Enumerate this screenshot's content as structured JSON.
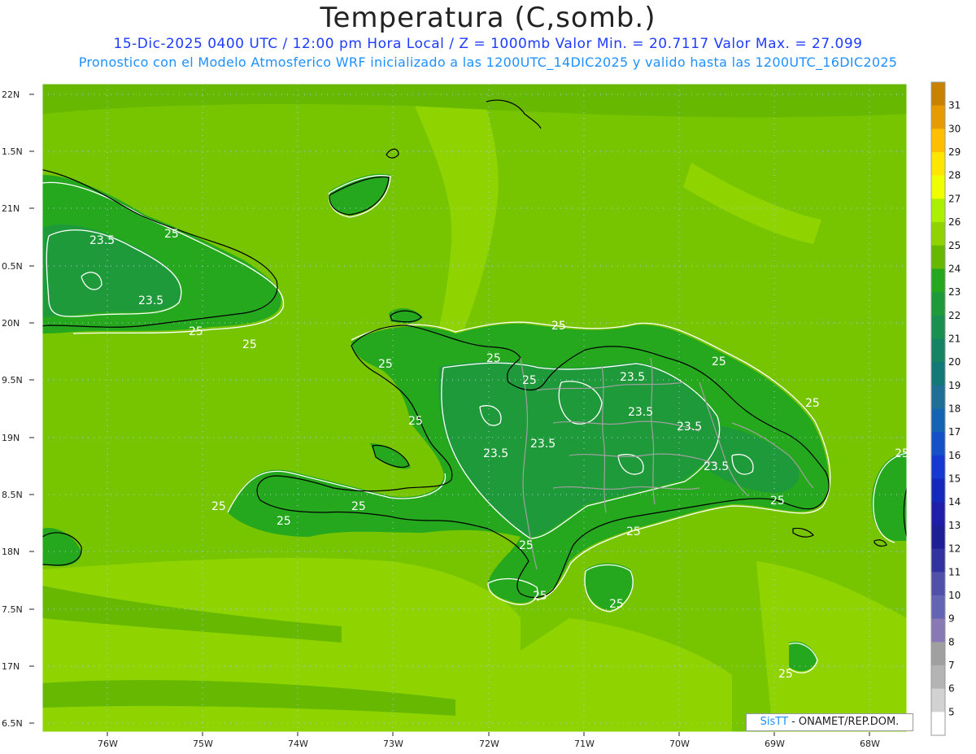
{
  "title": "Temperatura (C,somb.)",
  "subtitle_line1": "15-Dic-2025 0400 UTC / 12:00 pm Hora Local / Z = 1000mb   Valor Min. = 20.7117  Valor Max. = 27.099",
  "subtitle_line2": "Pronostico con el Modelo Atmosferico WRF inicializado a las 1200UTC_14DIC2025 y valido hasta las  1200UTC_16DIC2025",
  "credit": {
    "brand": "SisTT",
    "text": " - ONAMET/REP.DOM."
  },
  "map": {
    "lat_ticks": [
      "22N",
      "1.5N",
      "21N",
      "0.5N",
      "20N",
      "9.5N",
      "19N",
      "8.5N",
      "18N",
      "7.5N",
      "17N",
      "6.5N"
    ],
    "lon_ticks": [
      "76W",
      "75W",
      "74W",
      "73W",
      "72W",
      "71W",
      "70W",
      "69W",
      "68W"
    ],
    "contour_labels": [
      "23.5",
      "25",
      "23.5",
      "25",
      "25",
      "25",
      "25",
      "25",
      "25",
      "23.5",
      "25",
      "23.5",
      "23.5",
      "23.5",
      "23.5",
      "23.5",
      "25",
      "25",
      "25",
      "25",
      "25",
      "25",
      "25",
      "25",
      "25",
      "25",
      "25",
      "25"
    ],
    "colors": {
      "t26": "#8fd400",
      "t25": "#66b800",
      "t24": "#26a81e",
      "t23": "#1f9a3a",
      "coast": "#000000",
      "border": "#a0a0a0",
      "contour": "#ffffff"
    }
  },
  "colorbar": {
    "labels": [
      "31",
      "30",
      "29",
      "28",
      "27",
      "26",
      "25",
      "24",
      "23",
      "22",
      "21",
      "20",
      "19",
      "18",
      "17",
      "16",
      "15",
      "14",
      "13",
      "12",
      "11",
      "10",
      "9",
      "8",
      "7",
      "6",
      "5"
    ],
    "colors": [
      "#c88200",
      "#e69b00",
      "#ffbe00",
      "#ffe600",
      "#f0ff00",
      "#aaf000",
      "#8fd400",
      "#66b800",
      "#26a81e",
      "#1f9a3a",
      "#1a9050",
      "#168464",
      "#127878",
      "#1f6f96",
      "#1464b4",
      "#1450c8",
      "#1438d2",
      "#1428be",
      "#1e1eaa",
      "#1e1e96",
      "#3232a0",
      "#5050aa",
      "#6464b4",
      "#8878b4",
      "#a0a0a0",
      "#b4b4b4",
      "#d2d2d2",
      "#ffffff"
    ]
  }
}
